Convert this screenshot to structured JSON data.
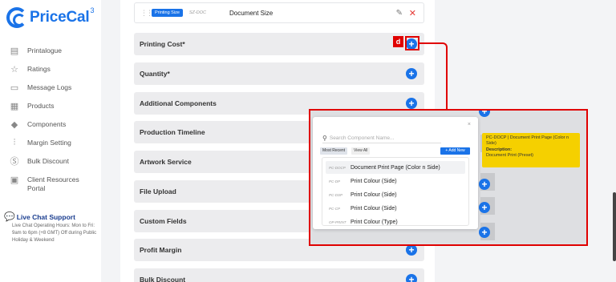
{
  "brand": {
    "name": "PriceCal",
    "superscript": "3"
  },
  "sidebar": {
    "items": [
      {
        "label": "Printalogue",
        "icon": "catalogue-icon"
      },
      {
        "label": "Ratings",
        "icon": "star-icon"
      },
      {
        "label": "Message Logs",
        "icon": "message-icon"
      },
      {
        "label": "Products",
        "icon": "grid-icon"
      },
      {
        "label": "Components",
        "icon": "puzzle-icon"
      },
      {
        "label": "Margin Setting",
        "icon": "sliders-icon"
      },
      {
        "label": "Bulk Discount",
        "icon": "dollar-icon"
      },
      {
        "label": "Client Resources Portal",
        "icon": "portal-icon"
      }
    ],
    "live_chat": {
      "title": "Live Chat Support",
      "body": "Live Chat Operating Hours: Mon to Fri: 9am to 6pm (+8 GMT) Off during Public Holiday & Weekend"
    }
  },
  "document_row": {
    "tag": "Printing Size",
    "code": "SZ-DOC",
    "name": "Document Size"
  },
  "sections": [
    {
      "label": "Printing Cost*"
    },
    {
      "label": "Quantity*"
    },
    {
      "label": "Additional Components"
    },
    {
      "label": "Production Timeline"
    },
    {
      "label": "Artwork Service"
    },
    {
      "label": "File Upload"
    },
    {
      "label": "Custom Fields"
    },
    {
      "label": "Profit Margin"
    },
    {
      "label": "Bulk Discount"
    }
  ],
  "annotation": {
    "marker": "d"
  },
  "modal": {
    "close": "×",
    "search_placeholder": "Search Component Name...",
    "filters": {
      "recent": "Most Recent",
      "all": "View All",
      "add": "+ Add New"
    },
    "items": [
      {
        "code": "PC-DOCP",
        "name": "Document Print Page (Color n Side)"
      },
      {
        "code": "PC-DP",
        "name": "Print Colour (Side)"
      },
      {
        "code": "PC-DSP",
        "name": "Print Colour (Side)"
      },
      {
        "code": "PC-CP",
        "name": "Print Colour (Side)"
      },
      {
        "code": "OP-PRINT",
        "name": "Print Colour (Type)"
      }
    ]
  },
  "tooltip": {
    "line1": "PC-DOCP | Document Print Page (Color n Side)",
    "label": "Description:",
    "desc": "Document Print (Preset)"
  },
  "colors": {
    "accent": "#1a73e8",
    "annotation": "#e00000",
    "tooltip": "#f5d000"
  }
}
